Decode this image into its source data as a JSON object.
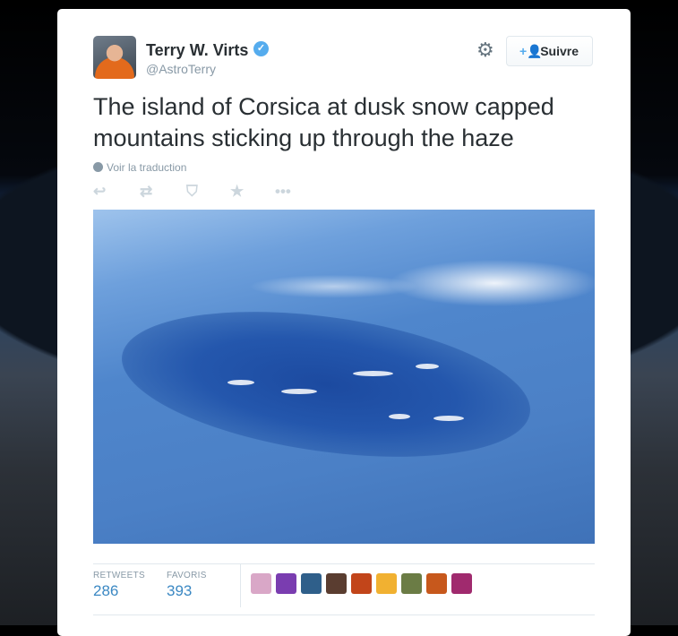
{
  "author": {
    "name": "Terry W. Virts",
    "handle": "@AstroTerry",
    "verified_icon": "verified-check-icon"
  },
  "header": {
    "follow_label": "Suivre",
    "follow_icon": "follow-user-plus-icon",
    "settings_icon": "gear-icon"
  },
  "tweet": {
    "text": "The island of Corsica at dusk snow capped mountains sticking up through the haze",
    "translate_label": "Voir la traduction",
    "photo_description_icon": "tweet-photo"
  },
  "actions": {
    "icons": [
      "reply-icon",
      "retweet-icon",
      "pocket-icon",
      "favorite-star-icon",
      "more-dots-icon"
    ]
  },
  "stats": {
    "retweets_label": "RETWEETS",
    "retweets_value": "286",
    "favorites_label": "FAVORIS",
    "favorites_value": "393"
  },
  "favoriters": [
    {
      "name": "favoriter-avatar-1",
      "color": "#d9a7c7"
    },
    {
      "name": "favoriter-avatar-2",
      "color": "#7a3db0"
    },
    {
      "name": "favoriter-avatar-3",
      "color": "#2f5f8a"
    },
    {
      "name": "favoriter-avatar-4",
      "color": "#5a3d30"
    },
    {
      "name": "favoriter-avatar-5",
      "color": "#c2451a"
    },
    {
      "name": "favoriter-avatar-6",
      "color": "#f1b131"
    },
    {
      "name": "favoriter-avatar-7",
      "color": "#6b7c45"
    },
    {
      "name": "favoriter-avatar-8",
      "color": "#c7581c"
    },
    {
      "name": "favoriter-avatar-9",
      "color": "#a02a6e"
    }
  ]
}
